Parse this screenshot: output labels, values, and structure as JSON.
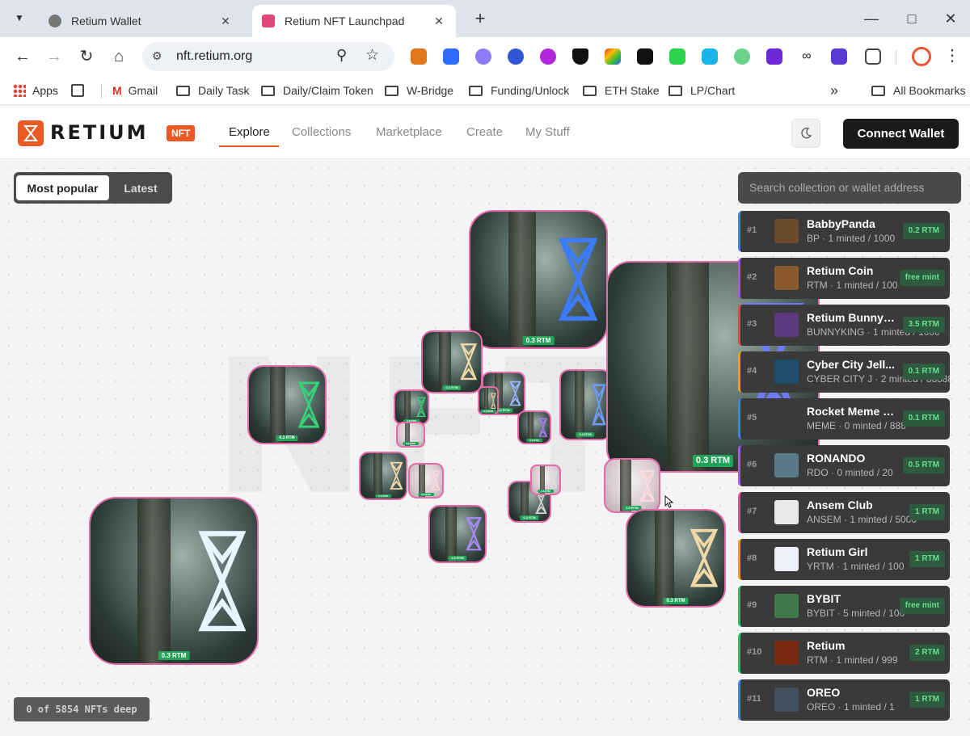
{
  "browser": {
    "tabs": [
      {
        "title": "Retium Wallet",
        "active": false
      },
      {
        "title": "Retium NFT Launchpad",
        "active": true
      }
    ],
    "url": "nft.retium.org",
    "bookmarks": [
      "Apps",
      "Gmail",
      "Daily Task",
      "Daily/Claim Token",
      "W-Bridge",
      "Funding/Unlock",
      "ETH Stake",
      "LP/Chart",
      "All Bookmarks"
    ],
    "overflow_label": "»"
  },
  "site": {
    "logo_text": "RETIUM",
    "logo_badge": "NFT",
    "nav": [
      "Explore",
      "Collections",
      "Marketplace",
      "Create",
      "My Stuff"
    ],
    "active_nav": "Explore",
    "connect_label": "Connect Wallet",
    "colors": {
      "brand": "#ec5a24",
      "price_badge": "#23a35a",
      "nft_border": "#e56aa8"
    }
  },
  "explore": {
    "filters": [
      "Most popular",
      "Latest"
    ],
    "selected_filter": "Most popular",
    "background_text": "NFT",
    "nft_prices": [
      "0.3 RTM",
      "0.3 RTM",
      "0.3 RTM",
      "0.3 RTM",
      "0.3 RTM",
      "0.3 RTM",
      "0.3 RTM",
      "0.3 RTM",
      "0.3 RTM",
      "0.3 RTM",
      "0.3 RTM",
      "0.3 RTM",
      "0.3 RTM",
      "0.3 RTM",
      "0.3 RTM",
      "0.3 RTM",
      "0.3 RTM",
      "0.3 RTM"
    ],
    "depth_counter": "0 of 5854 NFTs deep"
  },
  "sidebar": {
    "search_placeholder": "Search collection or wallet address",
    "collections": [
      {
        "rank": "#1",
        "name": "BabbyPanda",
        "meta": "BP · 1 minted / 1000",
        "price": "0.2 RTM",
        "accent": "#3b82f6"
      },
      {
        "rank": "#2",
        "name": "Retium Coin",
        "meta": "RTM · 1 minted / 100",
        "price": "free mint",
        "accent": "#a855f7"
      },
      {
        "rank": "#3",
        "name": "Retium Bunny ...",
        "meta": "BUNNYKING · 1 minted / 1000",
        "price": "3.5 RTM",
        "accent": "#ef4444"
      },
      {
        "rank": "#4",
        "name": "Cyber City Jell...",
        "meta": "CYBER CITY J · 2 minted / 88888",
        "price": "0.1 RTM",
        "accent": "#f59e0b"
      },
      {
        "rank": "#5",
        "name": "Rocket Meme C...",
        "meta": "MEME · 0 minted / 888",
        "price": "0.1 RTM",
        "accent": "#3b82f6"
      },
      {
        "rank": "#6",
        "name": "RONANDO",
        "meta": "RDO · 0 minted / 20",
        "price": "0.5 RTM",
        "accent": "#a855f7"
      },
      {
        "rank": "#7",
        "name": "Ansem Club",
        "meta": "ANSEM · 1 minted / 5000",
        "price": "1 RTM",
        "accent": "#ec4899"
      },
      {
        "rank": "#8",
        "name": "Retium Girl",
        "meta": "YRTM · 1 minted / 100",
        "price": "1 RTM",
        "accent": "#f59e0b"
      },
      {
        "rank": "#9",
        "name": "BYBIT",
        "meta": "BYBIT · 5 minted / 100",
        "price": "free mint",
        "accent": "#22c55e"
      },
      {
        "rank": "#10",
        "name": "Retium",
        "meta": "RTM · 1 minted / 999",
        "price": "2 RTM",
        "accent": "#22c55e"
      },
      {
        "rank": "#11",
        "name": "OREO",
        "meta": "OREO · 1 minted / 1",
        "price": "1 RTM",
        "accent": "#3b82f6"
      }
    ]
  }
}
